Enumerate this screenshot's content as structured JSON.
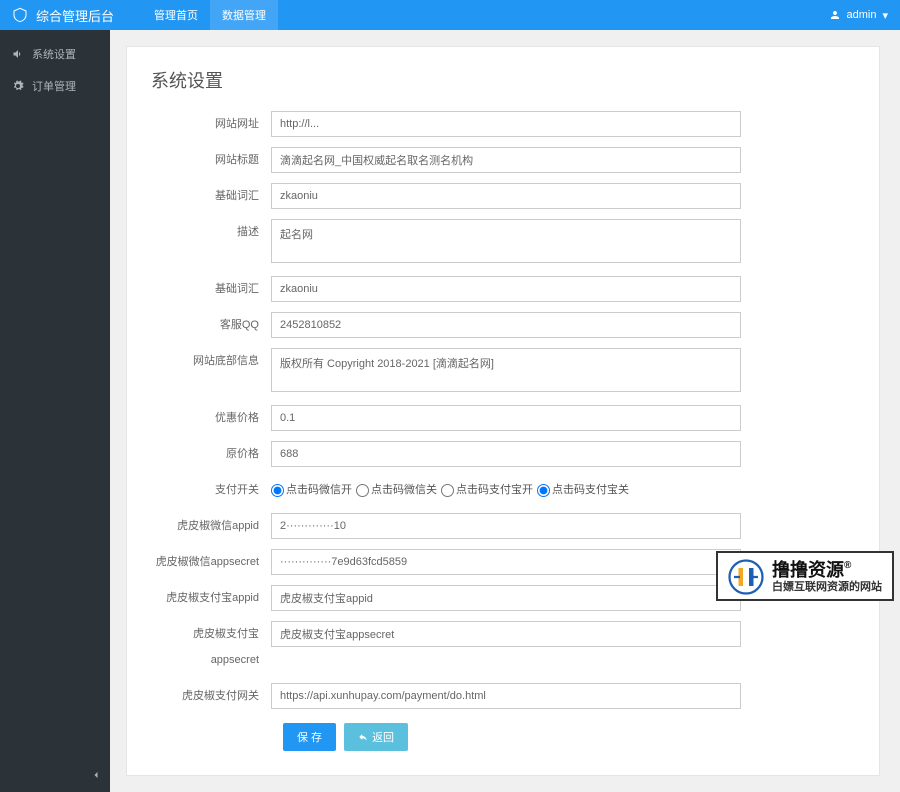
{
  "header": {
    "brand": "综合管理后台",
    "nav": [
      "管理首页",
      "数据管理"
    ],
    "user": "admin"
  },
  "sidebar": {
    "items": [
      {
        "icon": "volume",
        "label": "系统设置"
      },
      {
        "icon": "gear",
        "label": "订单管理"
      }
    ]
  },
  "page": {
    "title": "系统设置"
  },
  "form": {
    "site_url": {
      "label": "网站网址",
      "value": "http://l..."
    },
    "site_title": {
      "label": "网站标题",
      "value": "滴滴起名网_中国权威起名取名测名机构"
    },
    "keywords1": {
      "label": "基础词汇",
      "value": "zkaoniu"
    },
    "description": {
      "label": "描述",
      "value": "起名网"
    },
    "keywords2": {
      "label": "基础词汇",
      "value": "zkaoniu"
    },
    "service_qq": {
      "label": "客服QQ",
      "value": "2452810852"
    },
    "footer_info": {
      "label": "网站底部信息",
      "value": "版权所有 Copyright 2018-2021 [滴滴起名网]"
    },
    "promo_price": {
      "label": "优惠价格",
      "value": "0.1"
    },
    "original_price": {
      "label": "原价格",
      "value": "688"
    },
    "pay_switch": {
      "label": "支付开关",
      "options": [
        "点击码微信开",
        "点击码微信关",
        "点击码支付宝开",
        "点击码支付宝关"
      ],
      "selected": [
        0,
        3
      ]
    },
    "wx_appid": {
      "label": "虎皮椒微信appid",
      "value": "2·············10"
    },
    "wx_appsecret": {
      "label": "虎皮椒微信appsecret",
      "value": "··············7e9d63fcd5859"
    },
    "ali_appid": {
      "label": "虎皮椒支付宝appid",
      "value": "虎皮椒支付宝appid"
    },
    "ali_appsecret": {
      "label": "虎皮椒支付宝appsecret",
      "value": "虎皮椒支付宝appsecret"
    },
    "pay_gateway": {
      "label": "虎皮椒支付网关",
      "value": "https://api.xunhupay.com/payment/do.html"
    }
  },
  "buttons": {
    "save": "保 存",
    "back": "返回"
  },
  "watermark": {
    "line1": "撸撸资源",
    "reg": "®",
    "line2": "白嫖互联网资源的网站"
  }
}
